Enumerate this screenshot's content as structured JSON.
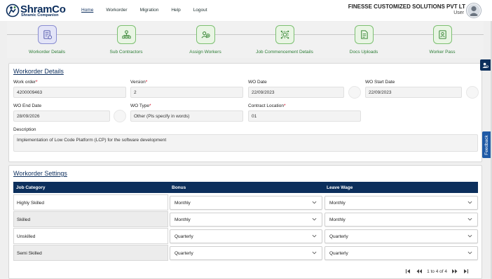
{
  "brand": {
    "name": "ShramCo",
    "tagline": "Shramic Companion"
  },
  "nav": {
    "home": "Home",
    "workorder": "Workorder",
    "migration": "Migration",
    "help": "Help",
    "logout": "Logout"
  },
  "header": {
    "org": "FINESSE CUSTOMIZED SOLUTIONS PVT LT",
    "user": "User"
  },
  "steps": [
    {
      "label": "Workorder Details",
      "icon": "workorder-icon",
      "active": true
    },
    {
      "label": "Sub Contractors",
      "icon": "org-chart-icon",
      "active": false
    },
    {
      "label": "Assign Workers",
      "icon": "assign-workers-icon",
      "active": false
    },
    {
      "label": "Job Commencement Details",
      "icon": "gear-network-icon",
      "active": false
    },
    {
      "label": "Docs Uploads",
      "icon": "document-icon",
      "active": false
    },
    {
      "label": "Worker Pass",
      "icon": "worker-pass-icon",
      "active": false
    }
  ],
  "details": {
    "title": "Workorder Details",
    "work_order_label": "Work order",
    "work_order": "4200009463",
    "version_label": "Version",
    "version": "2",
    "wo_date_label": "WO Date",
    "wo_date": "22/09/2023",
    "wo_start_date_label": "WO Start Date",
    "wo_start_date": "22/09/2023",
    "wo_end_date_label": "WO End Date",
    "wo_end_date": "28/09/2026",
    "wo_type_label": "WO Type",
    "wo_type": "Other (Pls specify in words)",
    "contract_location_label": "Contract Location",
    "contract_location": "01",
    "description_label": "Description",
    "description": "Implementation of Low Code Platform (LCP) for the software development",
    "required_mark": "*"
  },
  "settings": {
    "title": "Workorder Settings",
    "columns": [
      "Job Category",
      "Bonus",
      "Leave Wage"
    ],
    "rows": [
      {
        "category": "Highly Skilled",
        "bonus": "Monthly",
        "leave_wage": "Monthly"
      },
      {
        "category": "Skilled",
        "bonus": "Monthly",
        "leave_wage": "Monthly"
      },
      {
        "category": "Unskilled",
        "bonus": "Quarterly",
        "leave_wage": "Quarterly"
      },
      {
        "category": "Semi Skilled",
        "bonus": "Quarterly",
        "leave_wage": "Quarterly"
      }
    ]
  },
  "pager": {
    "text": "1 to 4 of 4"
  },
  "feedback": "Feedback",
  "colors": {
    "navy": "#0c2f5c",
    "green": "#2d7d36",
    "accent_blue": "#1f5aa6"
  }
}
